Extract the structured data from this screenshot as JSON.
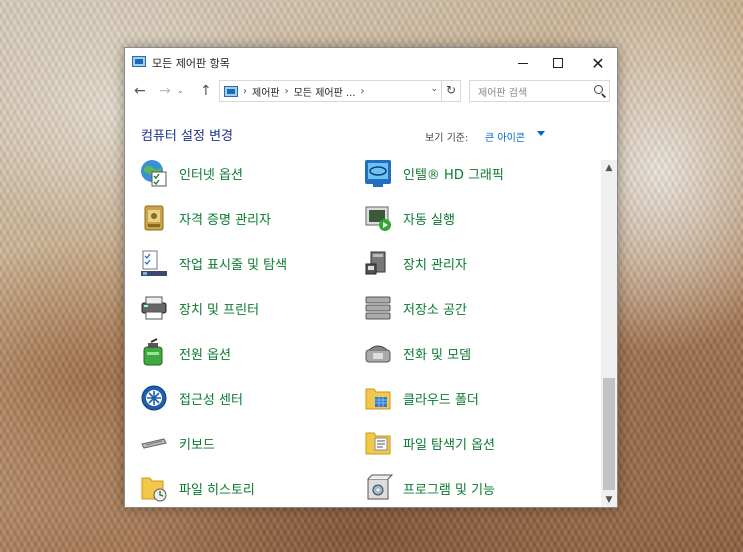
{
  "window": {
    "title": "모든 제어판 항목",
    "minimize": "",
    "maximize": "",
    "close": "✕"
  },
  "nav": {
    "back": "←",
    "forward": "→",
    "recent": "⌄",
    "up": "↑"
  },
  "address": {
    "crumbs": [
      "제어판",
      "모든 제어판 ..."
    ],
    "separators": [
      "›",
      "›",
      "›"
    ],
    "dropdown": "⌄",
    "refresh": "↻"
  },
  "search": {
    "placeholder": "제어판 검색"
  },
  "header": {
    "title": "컴퓨터 설정 변경",
    "view_by_label": "보기 기준:",
    "view_by_value": "큰 아이콘"
  },
  "items": [
    {
      "label": "인터넷 옵션",
      "icon": "internet-options-icon"
    },
    {
      "label": "인텔® HD 그래픽",
      "icon": "intel-graphics-icon"
    },
    {
      "label": "자격 증명 관리자",
      "icon": "credential-manager-icon"
    },
    {
      "label": "자동 실행",
      "icon": "autoplay-icon"
    },
    {
      "label": "작업 표시줄 및 탐색",
      "icon": "taskbar-icon"
    },
    {
      "label": "장치 관리자",
      "icon": "device-manager-icon"
    },
    {
      "label": "장치 및 프린터",
      "icon": "devices-printers-icon"
    },
    {
      "label": "저장소 공간",
      "icon": "storage-spaces-icon"
    },
    {
      "label": "전원 옵션",
      "icon": "power-options-icon"
    },
    {
      "label": "전화 및 모뎀",
      "icon": "phone-modem-icon"
    },
    {
      "label": "접근성 센터",
      "icon": "ease-of-access-icon"
    },
    {
      "label": "클라우드 폴더",
      "icon": "work-folders-icon"
    },
    {
      "label": "키보드",
      "icon": "keyboard-icon"
    },
    {
      "label": "파일 탐색기 옵션",
      "icon": "file-explorer-options-icon"
    },
    {
      "label": "파일 히스토리",
      "icon": "file-history-icon"
    },
    {
      "label": "프로그램 및 기능",
      "icon": "programs-features-icon"
    }
  ],
  "scrollbar": {
    "up": "▲",
    "down": "▼",
    "position": 0.76
  },
  "colors": {
    "item_label": "#0a7a2f",
    "title": "#1e3287",
    "link": "#0066cc"
  }
}
